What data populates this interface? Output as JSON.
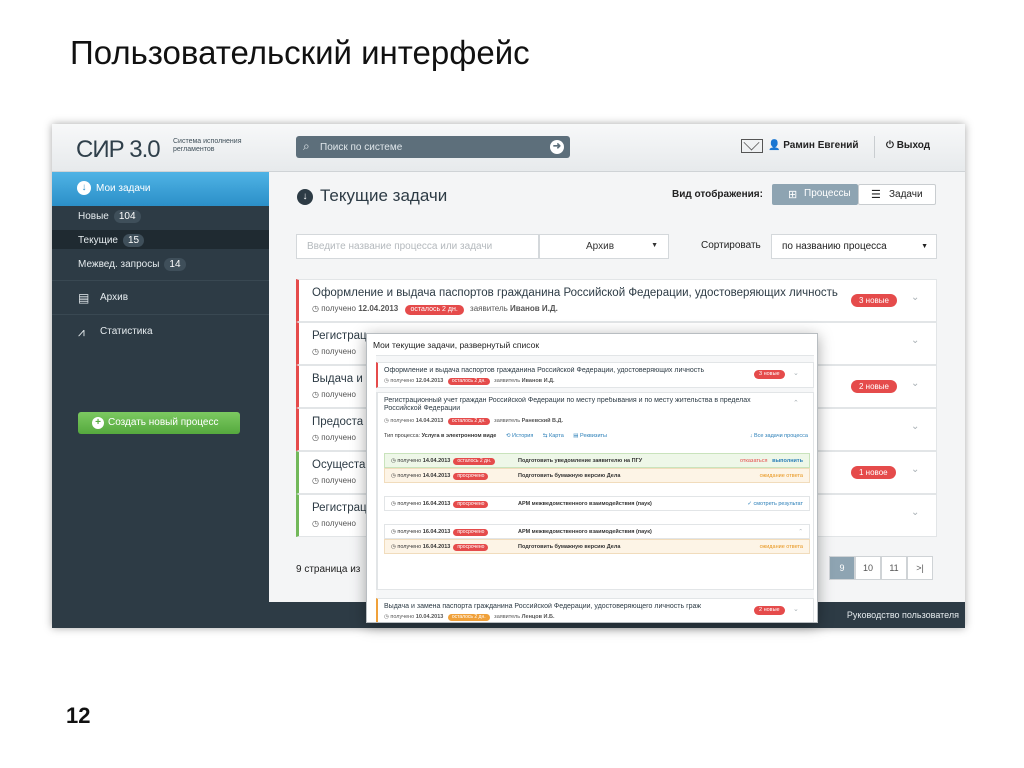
{
  "slide": {
    "title": "Пользовательский интерфейс",
    "number": "12"
  },
  "header": {
    "logo": "СИР 3.0",
    "logo_sub": "Система исполнения регламентов",
    "search_placeholder": "Поиск по системе",
    "user": "Рамин Евгений",
    "logout": "Выход"
  },
  "sidebar": {
    "my_tasks": "Мои задачи",
    "subitems": [
      {
        "label": "Новые",
        "count": "104"
      },
      {
        "label": "Текущие",
        "count": "15"
      },
      {
        "label": "Межвед. запросы",
        "count": "14"
      }
    ],
    "archive": "Архив",
    "stats": "Статистика",
    "create": "Создать новый процесс"
  },
  "main": {
    "title": "Текущие задачи",
    "view_label": "Вид отображения:",
    "view_processes": "Процессы",
    "view_tasks": "Задачи",
    "filter_placeholder": "Введите название процесса или задачи",
    "archive_select": "Архив",
    "sort_label": "Сортировать",
    "sort_value": "по названию процесса"
  },
  "tasks": [
    {
      "title": "Оформление и выдача паспортов гражданина Российской Федерации, удостоверяющих личность",
      "received": "получено",
      "date": "12.04.2013",
      "left": "осталось 2 дн.",
      "applicant_label": "заявитель",
      "applicant": "Иванов И.Д.",
      "badge": "3 новые"
    },
    {
      "title": "Регистрац",
      "received": "получено"
    },
    {
      "title": "Выдача и",
      "received": "получено",
      "badge": "2 новые"
    },
    {
      "title": "Предоста",
      "received": "получено"
    },
    {
      "title": "Осущеста",
      "received": "получено",
      "badge": "1 новое"
    },
    {
      "title": "Регистрац",
      "received": "получено"
    }
  ],
  "pager": {
    "info": "9 страница из",
    "pages": [
      "9",
      "10",
      "11",
      ">|"
    ]
  },
  "footer": {
    "guide": "Руководство пользователя"
  },
  "popup": {
    "title": "Мои текущие задачи, развернутый список",
    "item1": {
      "title": "Оформление и выдача паспортов гражданина Российской Федерации, удостоверяющих личность",
      "received": "получено",
      "date": "12.04.2013",
      "left": "осталось 2 дн.",
      "applicant_label": "заявитель",
      "applicant": "Иванов И.Д.",
      "badge": "3 новые"
    },
    "item2": {
      "title": "Регистрационный учет граждан Российской Федерации по месту пребывания и по месту жительства в пределах Российской Федерации",
      "received": "получено",
      "date": "14.04.2013",
      "left": "осталось 2 дн.",
      "applicant_label": "заявитель",
      "applicant": "Раневский В.Д.",
      "type_label": "Тип процесса:",
      "type": "Услуга в электронном виде",
      "history": "История",
      "map": "Карта",
      "requisites": "Реквизиты",
      "all_tasks": "Все задачи процесса"
    },
    "steps": [
      {
        "received": "получено",
        "date": "14.04.2013",
        "status": "осталось 2 дн.",
        "task": "Подготовить уведомление заявителю на ПГУ",
        "action1": "отказаться",
        "action2": "выполнить"
      },
      {
        "received": "получено",
        "date": "14.04.2013",
        "status": "просрочено",
        "task": "Подготовить бумажную версию Дела",
        "action1": "ожидание ответа"
      },
      {
        "received": "получено",
        "date": "16.04.2013",
        "status": "просрочено",
        "task": "АРМ межведомственного взаимодействия (паук)",
        "action1": "смотреть результат"
      },
      {
        "received": "получено",
        "date": "16.04.2013",
        "status": "просрочено",
        "task": "АРМ межведомственного взаимодействия (паук)"
      },
      {
        "received": "получено",
        "date": "16.04.2013",
        "status": "просрочено",
        "task": "Подготовить бумажную версию Дела",
        "action1": "ожидание ответа"
      }
    ],
    "item3": {
      "title": "Выдача и замена паспорта гражданина Российской Федерации, удостоверяющего личность граж",
      "received": "получено",
      "date": "10.04.2013",
      "left": "осталось 2 дн.",
      "applicant_label": "заявитель",
      "applicant": "Ленцов И.Б.",
      "badge": "2 новые"
    }
  },
  "colors": {
    "accent": "#2b8fc8",
    "danger": "#e54b4b",
    "success": "#72b85a",
    "warning": "#f0a13a",
    "sidebar": "#2d3b45"
  }
}
